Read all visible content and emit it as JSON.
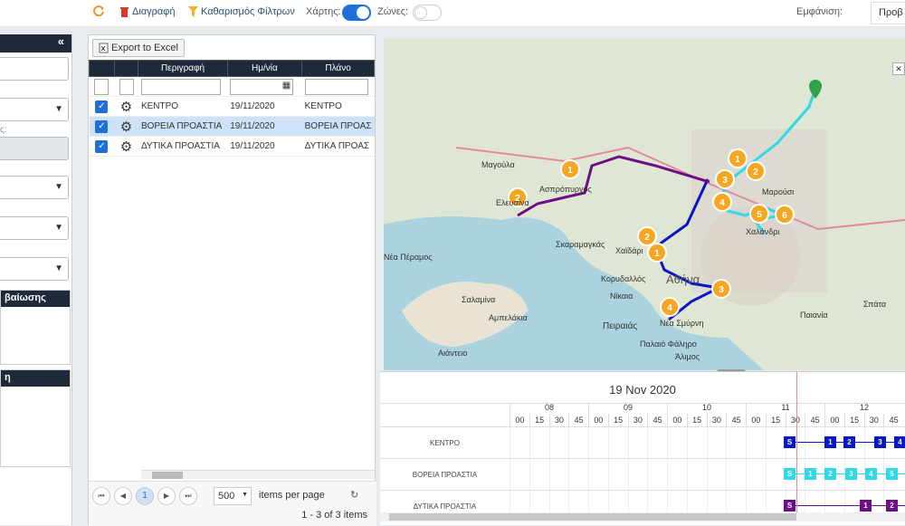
{
  "toolbar": {
    "delete_label": "Διαγραφή",
    "clear_filters_label": "Καθαρισμός Φίλτρων",
    "map_label": "Χάρτης:",
    "zones_label": "Ζώνες:",
    "display_label": "Εμφάνιση:",
    "display_value": "Προβ",
    "map_toggle_on": true,
    "zones_toggle_on": false,
    "accent_color": "#1e6fd9"
  },
  "sidebar": {
    "collapse_icon": "double-chevron-left",
    "partial_label": "ς:",
    "section1_label": "βαίωσης",
    "section2_label": "η"
  },
  "grid": {
    "export_label": "Export to Excel",
    "columns": [
      "Περιγραφή",
      "Ημ/νία",
      "Πλάνο"
    ],
    "rows": [
      {
        "desc": "ΚΕΝΤΡΟ",
        "date": "19/11/2020",
        "plan": "ΚΕΝΤΡΟ",
        "checked": true,
        "selected": false
      },
      {
        "desc": "ΒΟΡΕΙΑ ΠΡΟΑΣΤΙΑ",
        "date": "19/11/2020",
        "plan": "ΒΟΡΕΙΑ ΠΡΟΑΣ",
        "checked": true,
        "selected": true
      },
      {
        "desc": "ΔΥΤΙΚΑ ΠΡΟΑΣΤΙΑ",
        "date": "19/11/2020",
        "plan": "ΔΥΤΙΚΑ ΠΡΟΑΣ",
        "checked": true,
        "selected": false
      }
    ],
    "pager": {
      "current_page": "1",
      "page_size": "500",
      "items_per_page_label": "items per page",
      "summary": "1 - 3 of 3 items"
    }
  },
  "map": {
    "places": [
      "Μαγούλα",
      "Ασπρόπυργος",
      "Ελευσίνα",
      "Σκαραμαγκάς",
      "Χαϊδάρι",
      "Κορυδαλλός",
      "Νίκαια",
      "Πειραιάς",
      "Νέα Σμύρνη",
      "Παλαιό Φάληρο",
      "Άλιμος",
      "Σαλαμίνα",
      "Αμπελάκια",
      "Αιάντειο",
      "Μαρούσι",
      "Χαλάνδρι",
      "Παιανία",
      "Σπάτα",
      "Νέα Πέραμος",
      "Αθήνα"
    ],
    "route_colors": {
      "kentro": "#0a17c4",
      "voreia": "#2fd9e6",
      "dytika": "#6c0f86"
    },
    "marker_color": "#f5a623",
    "collapse_icon": "double-chevron-down"
  },
  "timeline": {
    "date": "19 Nov 2020",
    "hours": [
      "08",
      "09",
      "10",
      "11",
      "12"
    ],
    "quarters": [
      "00",
      "15",
      "30",
      "45"
    ],
    "rows": [
      {
        "name": "ΚΕΝΤΡΟ",
        "color": "#0a17c4",
        "stops": [
          "S",
          "1",
          "2",
          "3",
          "4"
        ]
      },
      {
        "name": "ΒΟΡΕΙΑ ΠΡΟΑΣΤΙΑ",
        "color": "#2fd9e6",
        "stops": [
          "S",
          "1",
          "2",
          "3",
          "4",
          "5"
        ]
      },
      {
        "name": "ΔΥΤΙΚΑ ΠΡΟΑΣΤΙΑ",
        "color": "#6c0f86",
        "stops": [
          "S",
          "1",
          "2"
        ]
      }
    ]
  }
}
